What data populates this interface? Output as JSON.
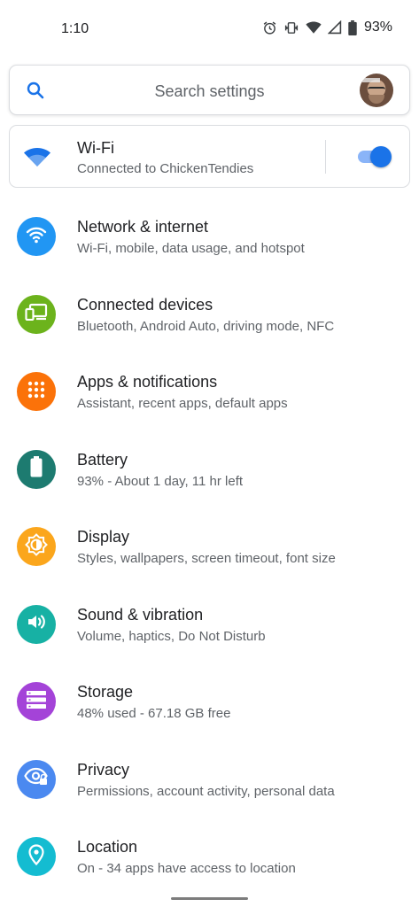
{
  "status_bar": {
    "time": "1:10",
    "battery_percent": "93%",
    "icons": [
      "alarm-icon",
      "vibrate-icon",
      "wifi-signal-icon",
      "cell-signal-icon",
      "battery-icon"
    ]
  },
  "search": {
    "placeholder": "Search settings",
    "icon": "search-icon",
    "avatar": "profile-avatar"
  },
  "wifi_card": {
    "title": "Wi-Fi",
    "subtitle": "Connected to ChickenTendies",
    "toggle_on": true,
    "accent": "#1a73e8"
  },
  "settings": [
    {
      "title": "Network & internet",
      "subtitle": "Wi-Fi, mobile, data usage, and hotspot",
      "icon": "wifi-icon",
      "color": "#2196f3"
    },
    {
      "title": "Connected devices",
      "subtitle": "Bluetooth, Android Auto, driving mode, NFC",
      "icon": "devices-icon",
      "color": "#6cb31c"
    },
    {
      "title": "Apps & notifications",
      "subtitle": "Assistant, recent apps, default apps",
      "icon": "apps-grid-icon",
      "color": "#fb7209"
    },
    {
      "title": "Battery",
      "subtitle": "93% - About 1 day, 11 hr left",
      "icon": "battery-icon",
      "color": "#1d7b70"
    },
    {
      "title": "Display",
      "subtitle": "Styles, wallpapers, screen timeout, font size",
      "icon": "brightness-icon",
      "color": "#fba61c"
    },
    {
      "title": "Sound & vibration",
      "subtitle": "Volume, haptics, Do Not Disturb",
      "icon": "volume-icon",
      "color": "#17b1a4"
    },
    {
      "title": "Storage",
      "subtitle": "48% used - 67.18 GB free",
      "icon": "storage-icon",
      "color": "#a443d8"
    },
    {
      "title": "Privacy",
      "subtitle": "Permissions, account activity, personal data",
      "icon": "privacy-eye-icon",
      "color": "#4b89f0"
    },
    {
      "title": "Location",
      "subtitle": "On - 34 apps have access to location",
      "icon": "location-pin-icon",
      "color": "#14bcd1"
    }
  ]
}
